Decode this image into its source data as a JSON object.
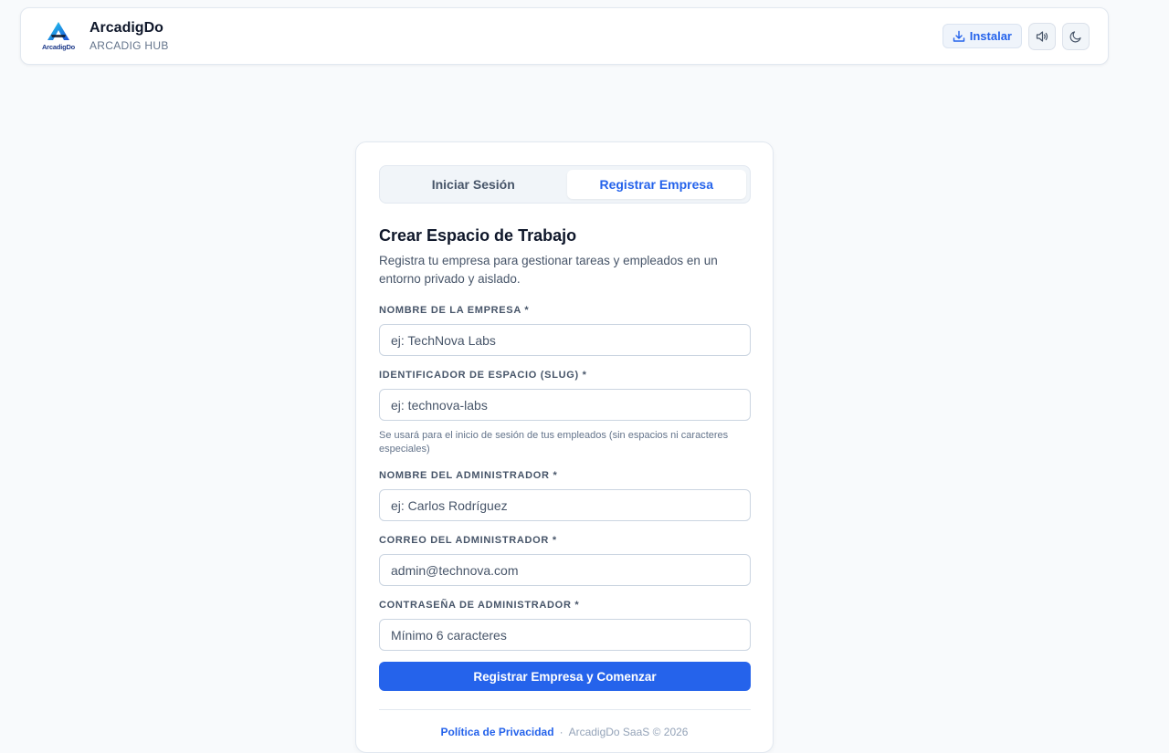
{
  "header": {
    "logo_text": "ArcadigDo",
    "brand_name": "ArcadigDo",
    "brand_sub": "ARCADIG HUB",
    "install_label": "Instalar",
    "icons": {
      "install": "download-icon",
      "sound": "speaker-icon",
      "theme": "moon-icon"
    }
  },
  "auth": {
    "tabs": [
      {
        "label": "Iniciar Sesión",
        "active": false
      },
      {
        "label": "Registrar Empresa",
        "active": true
      }
    ],
    "title": "Crear Espacio de Trabajo",
    "description": "Registra tu empresa para gestionar tareas y empleados en un entorno privado y aislado.",
    "fields": {
      "company": {
        "label": "NOMBRE DE LA EMPRESA *",
        "placeholder": "ej: TechNova Labs"
      },
      "slug": {
        "label": "IDENTIFICADOR DE ESPACIO (SLUG) *",
        "placeholder": "ej: technova-labs",
        "hint": "Se usará para el inicio de sesión de tus empleados (sin espacios ni caracteres especiales)"
      },
      "admin_name": {
        "label": "NOMBRE DEL ADMINISTRADOR *",
        "placeholder": "ej: Carlos Rodríguez"
      },
      "admin_email": {
        "label": "CORREO DEL ADMINISTRADOR *",
        "placeholder": "admin@technova.com"
      },
      "admin_password": {
        "label": "CONTRASEÑA DE ADMINISTRADOR *",
        "placeholder": "Mínimo 6 caracteres"
      }
    },
    "submit_label": "Registrar Empresa y Comenzar",
    "footer": {
      "privacy_link": "Política de Privacidad",
      "separator": "·",
      "copyright": "ArcadigDo SaaS © 2026"
    }
  },
  "colors": {
    "accent": "#2563eb",
    "background": "#f8fafc",
    "text_primary": "#0f172a",
    "text_muted": "#64748b"
  }
}
